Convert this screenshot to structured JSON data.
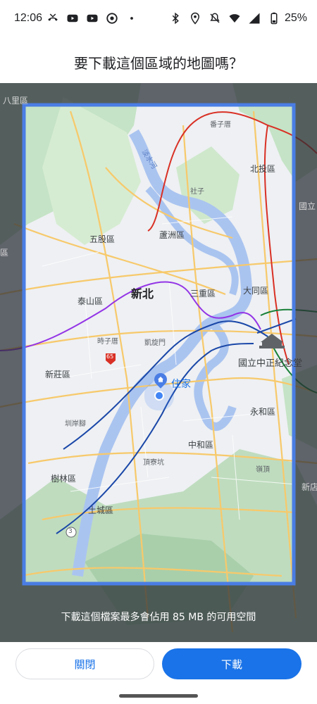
{
  "status_bar": {
    "time": "12:06",
    "battery": "25%",
    "left_icons": [
      "missed-call-icon",
      "youtube-icon",
      "youtube-icon",
      "chrome-icon",
      "dot-icon"
    ],
    "right_icons": [
      "bluetooth-icon",
      "location-icon",
      "mute-icon",
      "wifi-icon",
      "signal-icon",
      "battery-icon"
    ]
  },
  "dialog": {
    "title": "要下載這個區域的地圖嗎？",
    "info": "下載這個檔案最多會佔用 85 MB 的可用空間",
    "close_label": "關閉",
    "download_label": "下載"
  },
  "map": {
    "labels": {
      "bali": "八里區",
      "fanzikeng": "番子厝",
      "beitou": "北投區",
      "shezi": "社子",
      "keelung_river": "淡水河",
      "guoli": "國立",
      "wugu": "五股區",
      "luzhou": "蘆洲區",
      "xinbei": "新北",
      "taishan": "泰山區",
      "sanchong": "三重區",
      "datong": "大同區",
      "xi": "區",
      "shizichi": "時子厝",
      "kaixuanmen": "凱旋門",
      "xinzhuang": "新莊區",
      "cks": "國立中正紀念堂",
      "home": "住家",
      "yonghe": "永和區",
      "kanjiao": "圳岸腳",
      "zhonghe": "中和區",
      "dinliaokeng": "頂寮坑",
      "lingding": "嶺頂",
      "shulin": "樹林區",
      "xindian": "新店",
      "tucheng": "土城區",
      "route65": "65",
      "route3": "3"
    },
    "colors": {
      "selection": "#4a7de4",
      "mrt_red": "#d93025",
      "mrt_purple": "#9334e6",
      "mrt_blue": "#1a47a8",
      "mrt_green": "#188038",
      "river": "#aac4f0",
      "land": "#eef0f3",
      "park": "#c8e6c9",
      "road": "#f7c96b"
    }
  }
}
